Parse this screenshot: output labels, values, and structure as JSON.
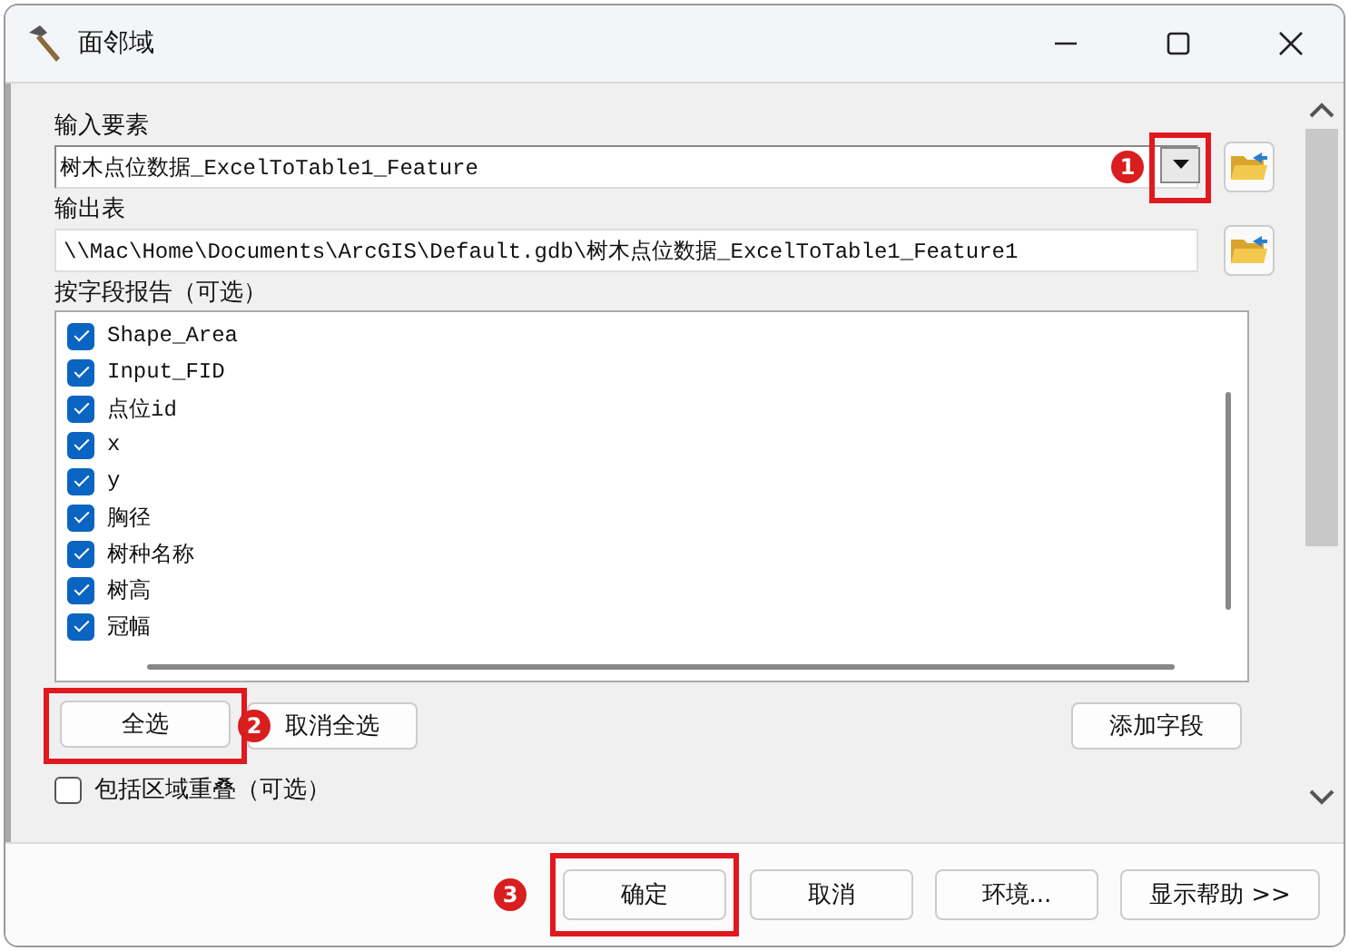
{
  "window": {
    "title": "面邻域"
  },
  "input_features": {
    "label": "输入要素",
    "value": "树木点位数据_ExcelToTable1_Feature",
    "callout": "1"
  },
  "output_table": {
    "label": "输出表",
    "value": "\\\\Mac\\Home\\Documents\\ArcGIS\\Default.gdb\\树木点位数据_ExcelToTable1_Feature1"
  },
  "report_fields": {
    "label": "按字段报告（可选）",
    "items": [
      {
        "label": "Shape_Area",
        "checked": true
      },
      {
        "label": "Input_FID",
        "checked": true
      },
      {
        "label": "点位id",
        "checked": true
      },
      {
        "label": "x",
        "checked": true
      },
      {
        "label": "y",
        "checked": true
      },
      {
        "label": "胸径",
        "checked": true
      },
      {
        "label": "树种名称",
        "checked": true
      },
      {
        "label": "树高",
        "checked": true
      },
      {
        "label": "冠幅",
        "checked": true
      }
    ]
  },
  "list_buttons": [
    {
      "label": "全选",
      "callout": "2"
    },
    {
      "label": "取消全选"
    },
    {
      "label": "添加字段"
    }
  ],
  "include_overlap": {
    "label": "包括区域重叠（可选）",
    "checked": false
  },
  "footer_buttons": [
    {
      "label": "确定",
      "callout": "3"
    },
    {
      "label": "取消"
    },
    {
      "label": "环境..."
    },
    {
      "label": "显示帮助 >>"
    }
  ]
}
